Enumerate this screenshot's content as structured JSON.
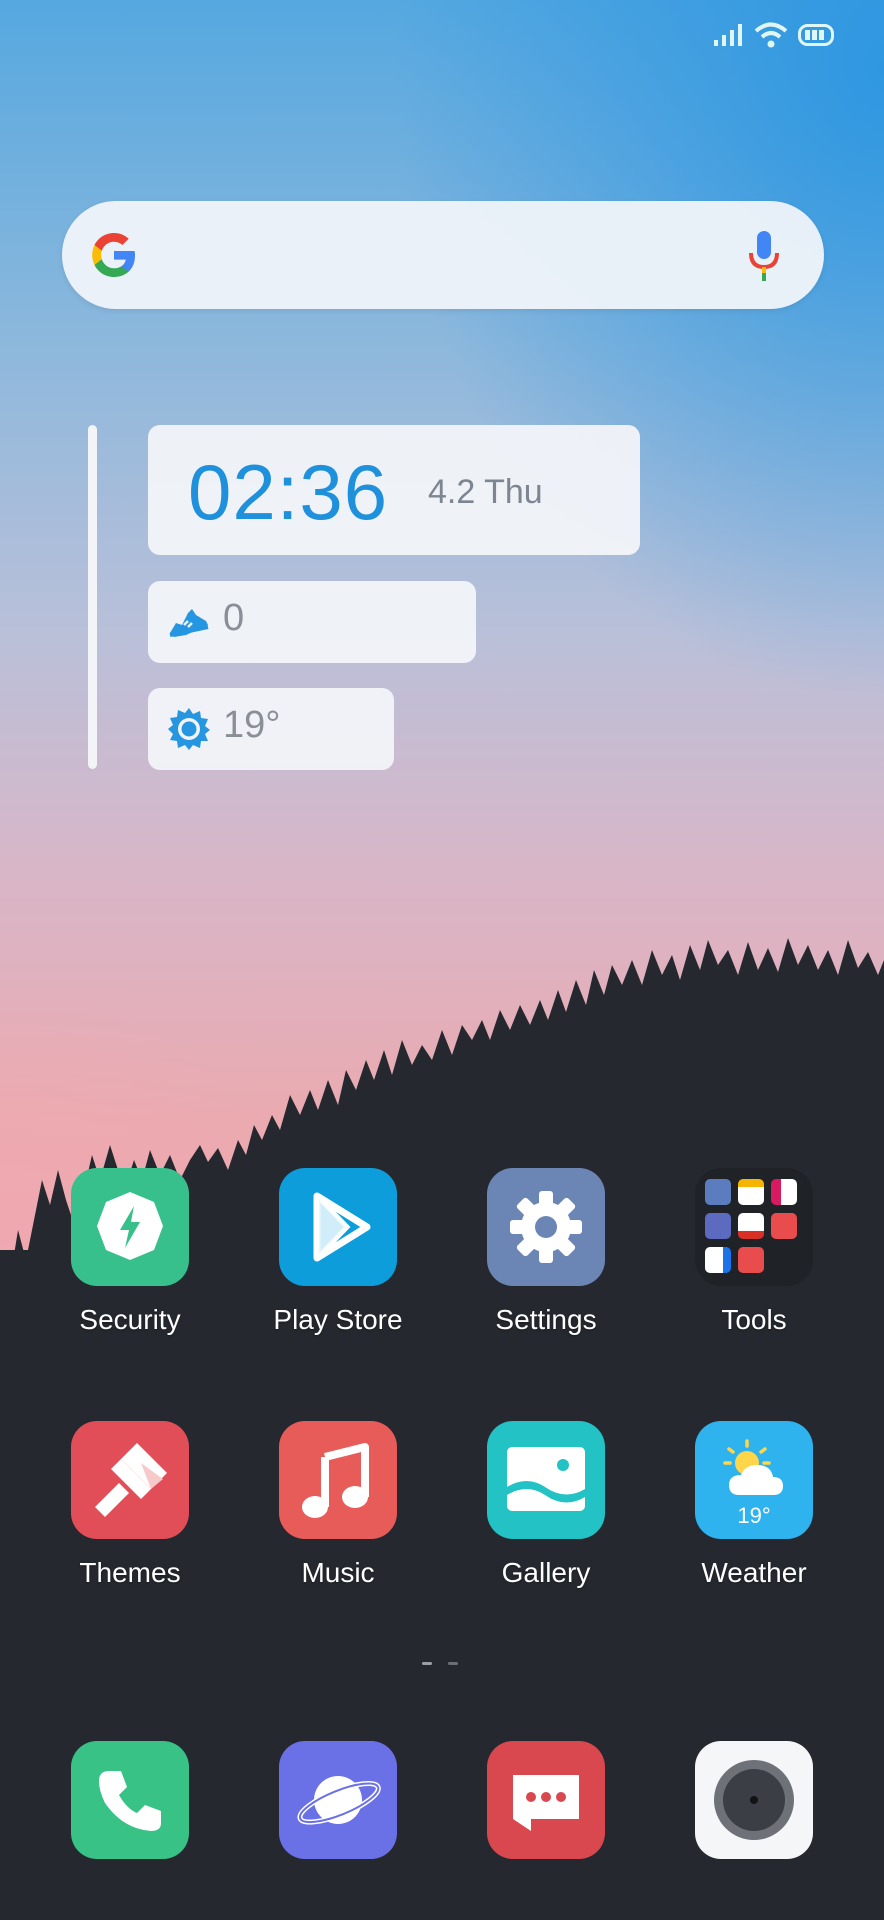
{
  "status_bar": {
    "icons": [
      "signal-icon",
      "wifi-icon",
      "battery-icon"
    ]
  },
  "search": {
    "icons": [
      "google-logo-icon",
      "microphone-icon"
    ]
  },
  "widget": {
    "time": "02:36",
    "date": "4.2 Thu",
    "steps": "0",
    "temperature": "19°"
  },
  "apps": [
    {
      "label": "Security",
      "icon": "security-icon",
      "color": "#38c08c"
    },
    {
      "label": "Play Store",
      "icon": "play-store-icon",
      "color": "#0d9ddb"
    },
    {
      "label": "Settings",
      "icon": "gear-icon",
      "color": "#6b86b5"
    },
    {
      "label": "Tools",
      "icon": "folder-icon",
      "color": "#1f2226"
    },
    {
      "label": "Themes",
      "icon": "themes-brush-icon",
      "color": "#e14e57"
    },
    {
      "label": "Music",
      "icon": "music-note-icon",
      "color": "#e75c59"
    },
    {
      "label": "Gallery",
      "icon": "gallery-icon",
      "color": "#23c2c4"
    },
    {
      "label": "Weather",
      "icon": "weather-icon",
      "color": "#2eb3ee",
      "temp": "19°"
    }
  ],
  "dock": [
    {
      "icon": "phone-icon",
      "color": "#38c286"
    },
    {
      "icon": "browser-planet-icon",
      "color": "#6a70e6"
    },
    {
      "icon": "messaging-icon",
      "color": "#d9474f"
    },
    {
      "icon": "camera-icon",
      "color": "#f5f6f8"
    }
  ]
}
